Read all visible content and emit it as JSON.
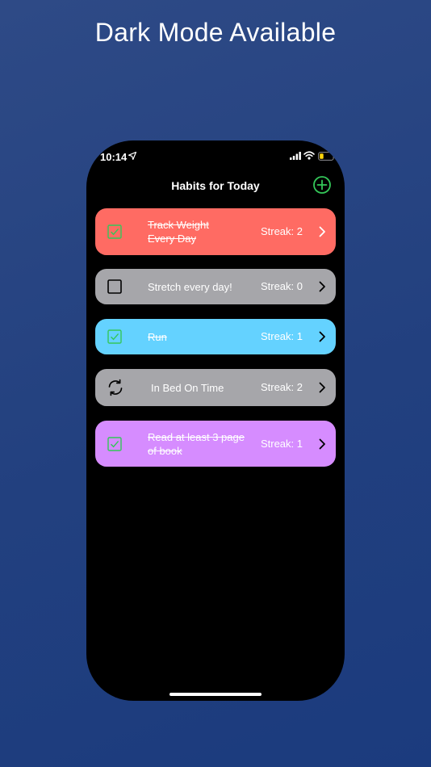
{
  "promo": {
    "headline": "Dark Mode Available"
  },
  "status_bar": {
    "time": "10:14",
    "icons": [
      "location-arrow-icon",
      "cellular-signal-icon",
      "wifi-icon",
      "battery-icon"
    ]
  },
  "nav": {
    "title": "Habits for Today",
    "add_icon": "plus-circle-icon"
  },
  "colors": {
    "accent_green": "#34c759",
    "card_red": "#ff6b63",
    "card_gray": "#a6a6aa",
    "card_blue": "#64d2ff",
    "card_purple": "#d68cff"
  },
  "habits": [
    {
      "name_line1": "Track Weight",
      "name_line2": "Every Day",
      "streak": "Streak: 2",
      "status": "done",
      "status_icon": "checkmark-square-icon",
      "color": "#ff6b63"
    },
    {
      "name": "Stretch every day!",
      "streak": "Streak: 0",
      "status": "todo",
      "status_icon": "empty-square-icon",
      "color": "#a6a6aa"
    },
    {
      "name": "Run",
      "streak": "Streak: 1",
      "status": "done",
      "status_icon": "checkmark-square-icon",
      "color": "#64d2ff"
    },
    {
      "name": "In Bed On Time",
      "streak": "Streak: 2",
      "status": "recurring",
      "status_icon": "refresh-arrows-icon",
      "color": "#a6a6aa"
    },
    {
      "name_line1": "Read at least 3 page",
      "name_line2": "of book",
      "streak": "Streak: 1",
      "status": "done",
      "status_icon": "checkmark-square-icon",
      "color": "#d68cff"
    }
  ]
}
